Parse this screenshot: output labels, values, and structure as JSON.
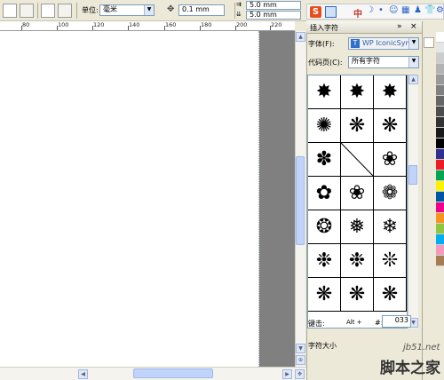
{
  "toolbar": {
    "unit_label": "单位:",
    "unit_value": "毫米",
    "nudge_value": "0.1 mm",
    "dup_x": "5.0 mm",
    "dup_y": "5.0 mm"
  },
  "ruler": {
    "labels": [
      "80",
      "100",
      "120",
      "140",
      "160",
      "180",
      "200",
      "220"
    ]
  },
  "docker": {
    "title": "插入字符",
    "font_label": "字体(F):",
    "font_value": "WP IconicSymb",
    "codepage_label": "代码页(C):",
    "codepage_value": "所有字符",
    "glyphs": [
      "✸",
      "✸",
      "✸",
      "✺",
      "❋",
      "❋",
      "✽",
      "⧄",
      "❀",
      "✿",
      "❀",
      "❁",
      "❂",
      "❅",
      "❄",
      "❉",
      "❉",
      "❊",
      "❋",
      "❋",
      "❋"
    ],
    "keystroke_label": "键击:",
    "alt_label": "Alt +",
    "hash_label": "#:",
    "code_value": "033",
    "char_size_label": "字符大小"
  },
  "ime": {
    "logo": "S",
    "mode": "中"
  },
  "watermark": {
    "domain": "jb51.net",
    "site": "脚本之家"
  },
  "colors": {
    "palette": [
      "#ffffff",
      "#e6e6e6",
      "#cccccc",
      "#b3b3b3",
      "#999999",
      "#808080",
      "#666666",
      "#4d4d4d",
      "#333333",
      "#1a1a1a",
      "#000000",
      "#2e3192",
      "#ed1c24",
      "#00a651",
      "#fff200",
      "#0054a6",
      "#ec008c",
      "#f7941d",
      "#8dc63f",
      "#00aeef",
      "#f49ac1",
      "#a67c52"
    ]
  }
}
